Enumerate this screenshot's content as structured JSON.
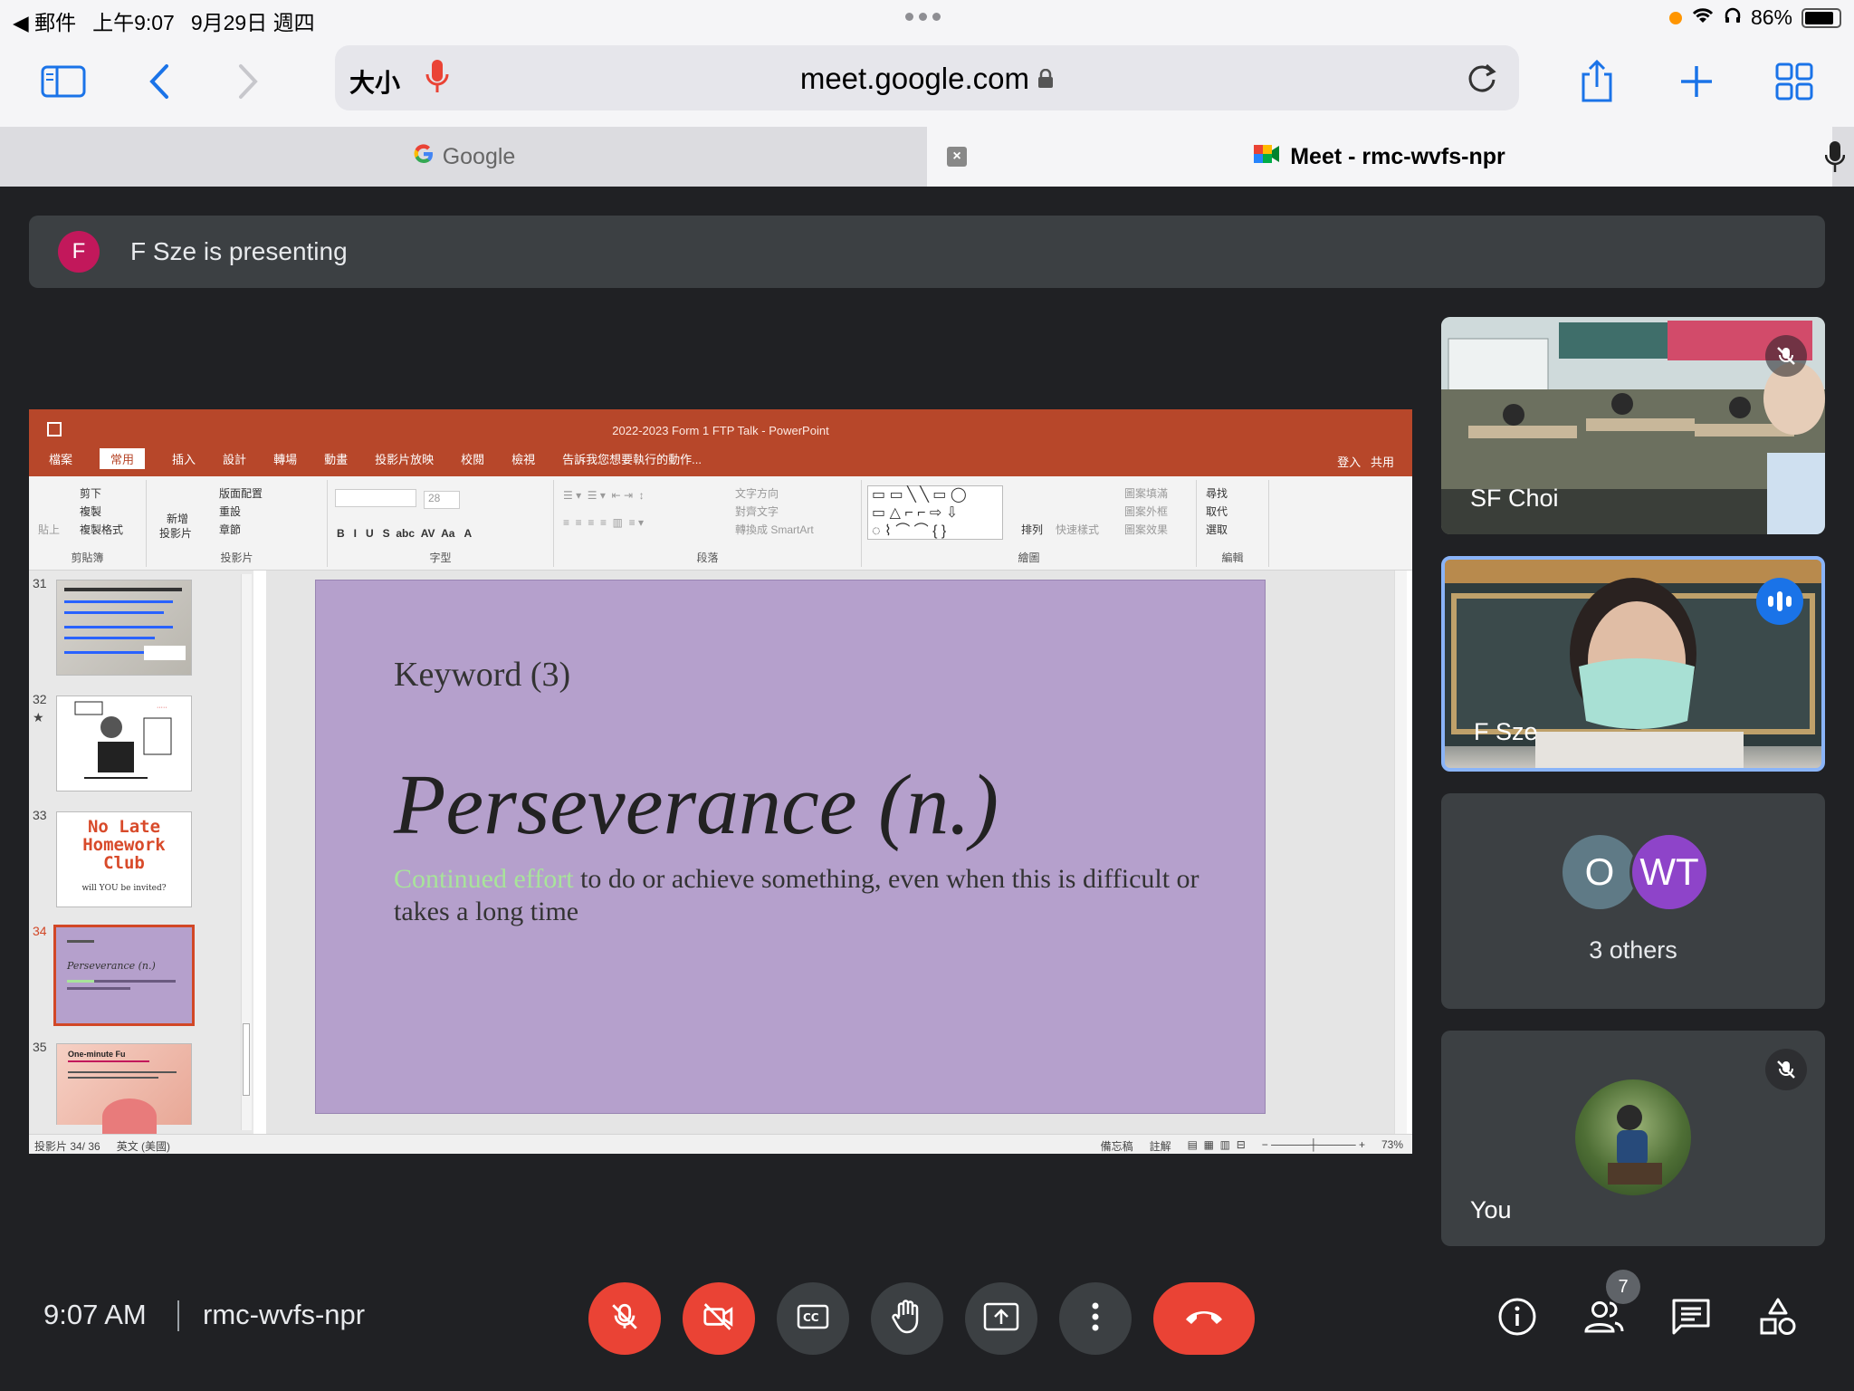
{
  "status": {
    "mail_back": "◀ 郵件",
    "time": "上午9:07",
    "date": "9月29日 週四",
    "battery": "86%"
  },
  "browser": {
    "text_size_label": "大小",
    "url": "meet.google.com"
  },
  "tabs": [
    {
      "title": "Google"
    },
    {
      "title": "Meet - rmc-wvfs-npr"
    }
  ],
  "banner": {
    "avatar_letter": "F",
    "text": "F Sze is presenting"
  },
  "ppt": {
    "window_title": "2022-2023 Form 1 FTP Talk - PowerPoint",
    "tabs": [
      "檔案",
      "常用",
      "插入",
      "設計",
      "轉場",
      "動畫",
      "投影片放映",
      "校閱",
      "檢視"
    ],
    "tell_me": "告訴我您想要執行的動作...",
    "login": "登入",
    "share": "共用",
    "ribbon": {
      "clipboard": {
        "paste": "貼上",
        "cut": "剪下",
        "copy": "複製",
        "format_painter": "複製格式",
        "label": "剪貼簿"
      },
      "slides": {
        "new_slide": "新增",
        "new_slide2": "投影片",
        "layout": "版面配置",
        "reset": "重設",
        "section": "章節",
        "label": "投影片"
      },
      "font": {
        "size": "28",
        "label": "字型"
      },
      "paragraph": {
        "text_direction": "文字方向",
        "align_text": "對齊文字",
        "smartart": "轉換成 SmartArt",
        "label": "段落"
      },
      "drawing": {
        "arrange": "排列",
        "quick_styles": "快速樣式",
        "fill": "圖案填滿",
        "outline": "圖案外框",
        "effects": "圖案效果",
        "label": "繪圖"
      },
      "editing": {
        "find": "尋找",
        "replace": "取代",
        "select": "選取",
        "label": "編輯"
      }
    },
    "thumbnails": [
      {
        "num": "31",
        "caption": ""
      },
      {
        "num": "32",
        "caption": ""
      },
      {
        "num": "33",
        "caption": "No Late Homework Club"
      },
      {
        "num": "34",
        "caption": "Perseverance (n.)"
      },
      {
        "num": "35",
        "caption": "One-minute Fu"
      }
    ],
    "thumb33_sub": "will YOU be invited?",
    "slide": {
      "keyword": "Keyword (3)",
      "word": "Perseverance (n.)",
      "def_highlight": "Continued effort",
      "def_rest": " to do or achieve something, even when this is difficult or takes a long time"
    },
    "statusbar": {
      "slide_count": "投影片 34/ 36",
      "language": "英文 (美國)",
      "notes": "備忘稿",
      "comments": "註解",
      "zoom": "73%"
    }
  },
  "participants": {
    "sf_choi": {
      "name": "SF Choi"
    },
    "f_sze": {
      "name": "F Sze"
    },
    "others": {
      "avatar1": "O",
      "avatar2": "WT",
      "label": "3 others"
    },
    "you": {
      "name": "You"
    }
  },
  "bottom": {
    "time": "9:07 AM",
    "meeting_code": "rmc-wvfs-npr",
    "people_count": "7"
  },
  "colors": {
    "accent": "#1a73e8",
    "danger": "#ea4335",
    "ppt_brand": "#b7472a",
    "slide_bg": "#b5a0cc"
  }
}
